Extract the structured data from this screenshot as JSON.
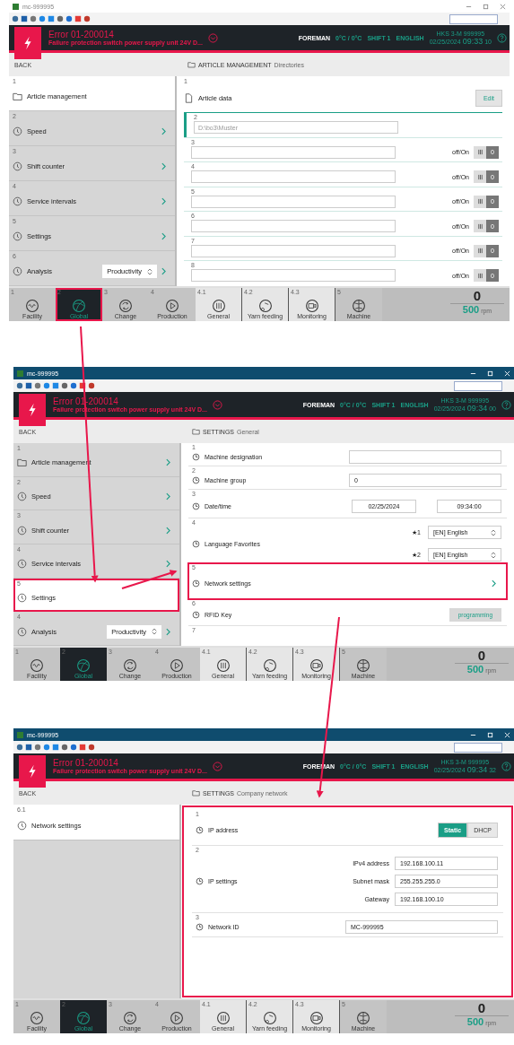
{
  "screens": [
    {
      "window": {
        "title": "mc-999995",
        "active": false
      },
      "error": {
        "code": "Error 01-200014",
        "message": "Failure protection switch power supply unit 24V D..."
      },
      "status": {
        "user": "FOREMAN",
        "temperature": "0°C / 0°C",
        "shift": "SHIFT 1",
        "language": "ENGLISH",
        "machine": "HKS 3-M 999995",
        "date": "02/25/2024",
        "time": "09:33",
        "seconds": "10"
      },
      "back": "BACK",
      "breadcrumb": {
        "title": "ARTICLE MANAGEMENT",
        "sub": "Directories"
      },
      "sidebar": [
        {
          "number": "1",
          "label": "Article management",
          "kind": "folder",
          "expandable": false,
          "selected": true,
          "highlighted": false
        },
        {
          "number": "2",
          "label": "Speed",
          "kind": "menu",
          "expandable": true,
          "selected": false,
          "highlighted": false
        },
        {
          "number": "3",
          "label": "Shift counter",
          "kind": "menu",
          "expandable": true,
          "selected": false,
          "highlighted": false
        },
        {
          "number": "4",
          "label": "Service intervals",
          "kind": "menu",
          "expandable": true,
          "selected": false,
          "highlighted": false
        },
        {
          "number": "5",
          "label": "Settings",
          "kind": "menu",
          "expandable": true,
          "selected": false,
          "highlighted": false
        },
        {
          "number": "6",
          "label": "Analysis",
          "kind": "menu",
          "expandable": true,
          "selected": false,
          "highlighted": false,
          "select": "Productivity"
        }
      ],
      "content": {
        "kind": "article",
        "number": "1",
        "title": "Article data",
        "edit_button": "Edit",
        "rows": [
          {
            "number": "2",
            "placeholder": "D:\\bo3\\Muster",
            "selected": true
          },
          {
            "number": "3",
            "mode_label": "off/On",
            "switch_label": "0",
            "on": false,
            "selected": false
          },
          {
            "number": "4",
            "mode_label": "off/On",
            "switch_label": "0",
            "on": false,
            "selected": false
          },
          {
            "number": "5",
            "mode_label": "off/On",
            "switch_label": "0",
            "on": false,
            "selected": false
          },
          {
            "number": "6",
            "mode_label": "off/On",
            "switch_label": "0",
            "on": false,
            "selected": false
          },
          {
            "number": "7",
            "mode_label": "off/On",
            "switch_label": "0",
            "on": false,
            "selected": false
          },
          {
            "number": "8",
            "mode_label": "off/On",
            "switch_label": "0",
            "on": false,
            "selected": false
          }
        ]
      },
      "nav": [
        {
          "number": "1",
          "label": "Facility",
          "kind": "main",
          "selected": false,
          "highlighted": false
        },
        {
          "number": "2",
          "label": "Global",
          "kind": "main",
          "selected": true,
          "highlighted": true
        },
        {
          "number": "3",
          "label": "Change",
          "kind": "main",
          "selected": false,
          "highlighted": false
        },
        {
          "number": "4",
          "label": "Production",
          "kind": "main",
          "selected": false,
          "highlighted": false
        },
        {
          "number": "4.1",
          "label": "General",
          "kind": "sub",
          "selected": false,
          "highlighted": false
        },
        {
          "number": "4.2",
          "label": "Yarn feeding",
          "kind": "sub",
          "selected": false,
          "highlighted": false
        },
        {
          "number": "4.3",
          "label": "Monitoring",
          "kind": "sub",
          "selected": false,
          "highlighted": false
        },
        {
          "number": "5",
          "label": "Machine",
          "kind": "main",
          "selected": false,
          "highlighted": false
        }
      ],
      "counter": {
        "value": "0",
        "speed": "500",
        "unit": "rpm"
      }
    },
    {
      "window": {
        "title": "mc-999995",
        "active": true
      },
      "error": {
        "code": "Error 01-200014",
        "message": "Failure protection switch power supply unit 24V D..."
      },
      "status": {
        "user": "FOREMAN",
        "temperature": "0°C / 0°C",
        "shift": "SHIFT 1",
        "language": "ENGLISH",
        "machine": "HKS 3-M 999995",
        "date": "02/25/2024",
        "time": "09:34",
        "seconds": "00"
      },
      "back": "BACK",
      "breadcrumb": {
        "title": "SETTINGS",
        "sub": "General"
      },
      "sidebar": [
        {
          "number": "1",
          "label": "Article management",
          "kind": "folder",
          "expandable": true,
          "selected": false,
          "highlighted": false
        },
        {
          "number": "2",
          "label": "Speed",
          "kind": "menu",
          "expandable": true,
          "selected": false,
          "highlighted": false
        },
        {
          "number": "3",
          "label": "Shift counter",
          "kind": "menu",
          "expandable": true,
          "selected": false,
          "highlighted": false
        },
        {
          "number": "4",
          "label": "Service intervals",
          "kind": "menu",
          "expandable": true,
          "selected": false,
          "highlighted": false
        },
        {
          "number": "5",
          "label": "Settings",
          "kind": "menu",
          "expandable": false,
          "selected": true,
          "highlighted": true
        },
        {
          "number": "4",
          "label": "Analysis",
          "kind": "menu",
          "expandable": true,
          "selected": false,
          "highlighted": false,
          "select": "Productivity"
        }
      ],
      "content": {
        "kind": "settings",
        "rows": [
          {
            "kind": "field",
            "number": "1",
            "label": "Machine designation",
            "highlighted": false
          },
          {
            "kind": "field",
            "number": "2",
            "label": "Machine group",
            "value": "0",
            "highlighted": false
          },
          {
            "kind": "pair",
            "number": "3",
            "label": "Date/time",
            "values": [
              "02/25/2024",
              "09:34:00"
            ],
            "highlighted": false
          },
          {
            "kind": "favorites",
            "number": "4",
            "label": "Language Favorites",
            "options": [
              {
                "star": "★1",
                "value": "[EN] English"
              },
              {
                "star": "★2",
                "value": "[EN] English"
              }
            ],
            "highlighted": false
          },
          {
            "kind": "link",
            "number": "5",
            "label": "Network settings",
            "highlighted": true
          },
          {
            "kind": "button",
            "number": "6",
            "label": "RFID Key",
            "button": "programming",
            "highlighted": false
          },
          {
            "kind": "empty",
            "number": "7",
            "highlighted": false
          }
        ]
      },
      "nav": [
        {
          "number": "1",
          "label": "Facility",
          "kind": "main",
          "selected": false,
          "highlighted": false
        },
        {
          "number": "2",
          "label": "Global",
          "kind": "main",
          "selected": true,
          "highlighted": false
        },
        {
          "number": "3",
          "label": "Change",
          "kind": "main",
          "selected": false,
          "highlighted": false
        },
        {
          "number": "4",
          "label": "Production",
          "kind": "main",
          "selected": false,
          "highlighted": false
        },
        {
          "number": "4.1",
          "label": "General",
          "kind": "sub",
          "selected": false,
          "highlighted": false
        },
        {
          "number": "4.2",
          "label": "Yarn feeding",
          "kind": "sub",
          "selected": false,
          "highlighted": false
        },
        {
          "number": "4.3",
          "label": "Monitoring",
          "kind": "sub",
          "selected": false,
          "highlighted": false
        },
        {
          "number": "5",
          "label": "Machine",
          "kind": "main",
          "selected": false,
          "highlighted": false
        }
      ],
      "counter": {
        "value": "0",
        "speed": "500",
        "unit": "rpm"
      }
    },
    {
      "window": {
        "title": "mc-999995",
        "active": true
      },
      "error": {
        "code": "Error 01-200014",
        "message": "Failure protection switch power supply unit 24V D..."
      },
      "status": {
        "user": "FOREMAN",
        "temperature": "0°C / 0°C",
        "shift": "SHIFT 1",
        "language": "ENGLISH",
        "machine": "HKS 3-M 999995",
        "date": "02/25/2024",
        "time": "09:34",
        "seconds": "32"
      },
      "back": "BACK",
      "breadcrumb": {
        "title": "SETTINGS",
        "sub": "Company network"
      },
      "sidebar": [
        {
          "number": "6.1",
          "label": "Network settings",
          "kind": "menu",
          "expandable": false,
          "selected": true,
          "highlighted": false
        }
      ],
      "content": {
        "kind": "network",
        "highlighted": true,
        "rows": [
          {
            "kind": "segmented",
            "number": "1",
            "label": "IP address",
            "options": [
              {
                "label": "Static",
                "selected": true
              },
              {
                "label": "DHCP",
                "selected": false
              }
            ]
          },
          {
            "kind": "address",
            "number": "2",
            "label": "IP settings",
            "fields": [
              {
                "label": "IPv4 address",
                "value": "192.168.100.11"
              },
              {
                "label": "Subnet mask",
                "value": "255.255.255.0"
              },
              {
                "label": "Gateway",
                "value": "192.168.100.10"
              }
            ]
          },
          {
            "kind": "field",
            "number": "3",
            "label": "Network ID",
            "value": "MC-999995"
          }
        ]
      },
      "nav": [
        {
          "number": "1",
          "label": "Facility",
          "kind": "main",
          "selected": false,
          "highlighted": false
        },
        {
          "number": "2",
          "label": "Global",
          "kind": "main",
          "selected": true,
          "highlighted": false
        },
        {
          "number": "3",
          "label": "Change",
          "kind": "main",
          "selected": false,
          "highlighted": false
        },
        {
          "number": "4",
          "label": "Production",
          "kind": "main",
          "selected": false,
          "highlighted": false
        },
        {
          "number": "4.1",
          "label": "General",
          "kind": "sub",
          "selected": false,
          "highlighted": false
        },
        {
          "number": "4.2",
          "label": "Yarn feeding",
          "kind": "sub",
          "selected": false,
          "highlighted": false
        },
        {
          "number": "4.3",
          "label": "Monitoring",
          "kind": "sub",
          "selected": false,
          "highlighted": false
        },
        {
          "number": "5",
          "label": "Machine",
          "kind": "main",
          "selected": false,
          "highlighted": false
        }
      ],
      "counter": {
        "value": "0",
        "speed": "500",
        "unit": "rpm"
      }
    }
  ]
}
